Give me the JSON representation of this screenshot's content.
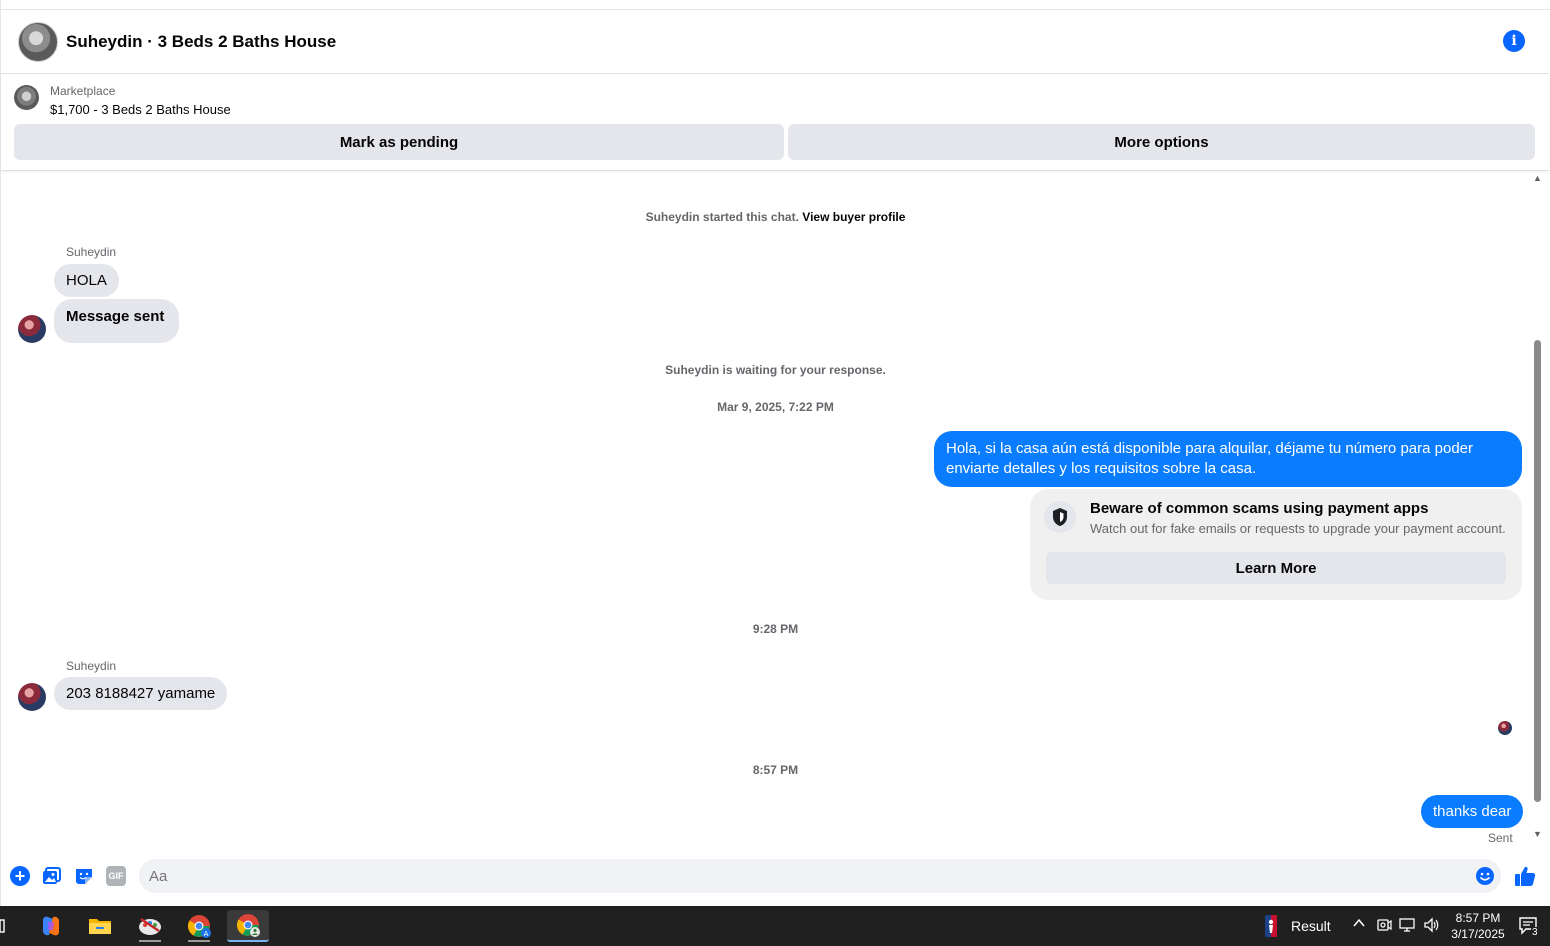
{
  "header": {
    "title": "Suheydin · 3 Beds 2 Baths House"
  },
  "listing": {
    "kicker": "Marketplace",
    "price_title": "$1,700 - 3 Beds 2 Baths House",
    "mark_pending_label": "Mark as pending",
    "more_options_label": "More options"
  },
  "conversation": {
    "started_note": "Suheydin started this chat.",
    "view_profile_link": "View buyer profile",
    "waiting_note": "Suheydin is waiting for your response.",
    "timestamps": [
      "Mar 9, 2025, 7:22 PM",
      "9:28 PM",
      "8:57 PM"
    ],
    "messages": [
      {
        "sender": "Suheydin",
        "text": "HOLA"
      },
      {
        "sender": "Suheydin",
        "text": "Message sent"
      },
      {
        "sender": "me",
        "text": "Hola, si la casa aún está disponible para alquilar, déjame tu número para poder enviarte detalles y los requisitos sobre la casa."
      },
      {
        "sender": "Suheydin",
        "text": "203 8188427 yamame"
      },
      {
        "sender": "me",
        "text": "thanks dear"
      }
    ],
    "sent_status": "Sent"
  },
  "scam_notice": {
    "title": "Beware of common scams using payment apps",
    "body": "Watch out for fake emails or requests to upgrade your payment account.",
    "button_label": "Learn More"
  },
  "composer": {
    "placeholder": "Aa",
    "gif_label": "GIF"
  },
  "taskbar": {
    "widget_label": "Result",
    "time": "8:57 PM",
    "date": "3/17/2025",
    "notification_count": "3"
  },
  "colors": {
    "accent": "#0866ff",
    "outgoing_bubble": "#0a7cff",
    "incoming_bubble": "#e4e6eb"
  }
}
